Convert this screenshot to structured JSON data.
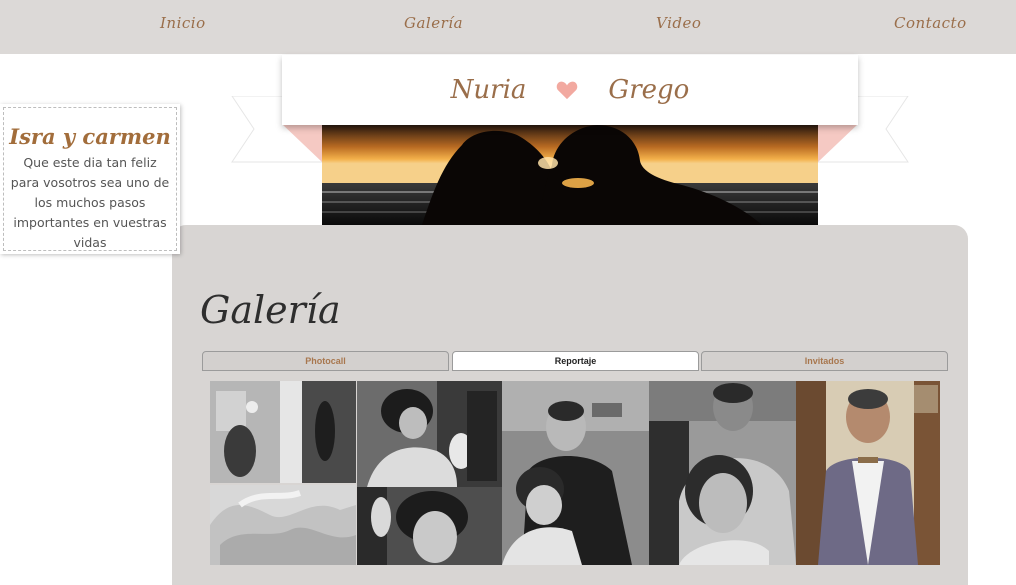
{
  "nav": {
    "items": [
      {
        "label": "Inicio"
      },
      {
        "label": "Galería"
      },
      {
        "label": "Video"
      },
      {
        "label": "Contacto"
      }
    ]
  },
  "banner": {
    "name_left": "Nuria",
    "name_right": "Grego",
    "heart_color": "#f2a9a0"
  },
  "note": {
    "title": "Isra y carmen",
    "message": "Que este dia tan feliz para vosotros sea uno de los muchos pasos importantes en vuestras vidas"
  },
  "gallery": {
    "title": "Galería",
    "tabs": [
      {
        "label": "Photocall",
        "active": false
      },
      {
        "label": "Reportaje",
        "active": true
      },
      {
        "label": "Invitados",
        "active": false
      }
    ]
  },
  "colors": {
    "accent": "#9a6e4a",
    "panel": "#d8d5d3",
    "ribbon_pink": "#f5c9c3"
  }
}
